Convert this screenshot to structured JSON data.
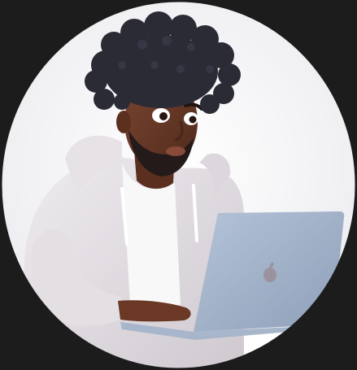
{
  "image": {
    "subject_icon": "person-with-laptop-avatar",
    "laptop_logo_icon": "apple-logo-icon",
    "colors": {
      "frame_background": "#1c1c1c",
      "circle_background": "#f4f3f6",
      "hoodie": "#e4e0e4",
      "tshirt": "#f7f7f7",
      "skin": "#6b3b27",
      "hair": "#2a2a35",
      "laptop": "#9eb0c8",
      "desk": "#ffffff"
    }
  }
}
